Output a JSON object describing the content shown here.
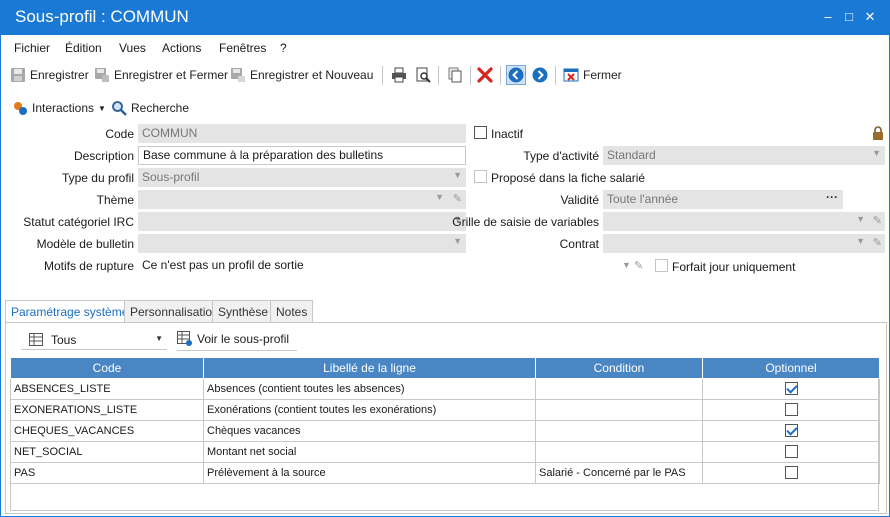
{
  "window": {
    "title": "Sous-profil : COMMUN",
    "controls": {
      "minimize": "–",
      "maximize": "□",
      "close": "✕"
    }
  },
  "menu": [
    "Fichier",
    "Édition",
    "Vues",
    "Actions",
    "Fenêtres",
    "?"
  ],
  "toolbar": {
    "save": "Enregistrer",
    "save_close": "Enregistrer et Fermer",
    "save_new": "Enregistrer et Nouveau",
    "close": "Fermer"
  },
  "toolbar2": {
    "interactions": "Interactions",
    "search": "Recherche"
  },
  "form": {
    "code": {
      "label": "Code",
      "value": "COMMUN"
    },
    "description": {
      "label": "Description",
      "value": "Base commune à la préparation des bulletins"
    },
    "type_profil": {
      "label": "Type du profil",
      "value": "Sous-profil"
    },
    "theme": {
      "label": "Thème",
      "value": ""
    },
    "statut_irc": {
      "label": "Statut catégoriel IRC",
      "value": ""
    },
    "modele_bulletin": {
      "label": "Modèle de bulletin",
      "value": ""
    },
    "motifs_rupture": {
      "label": "Motifs de rupture",
      "value": "Ce n'est pas un profil de sortie"
    },
    "inactif": {
      "label": "Inactif",
      "checked": false
    },
    "type_activite": {
      "label": "Type d'activité",
      "value": "Standard"
    },
    "propose_fiche": {
      "label": "Proposé dans la fiche salarié",
      "checked": false
    },
    "validite": {
      "label": "Validité",
      "value": "Toute l'année"
    },
    "grille_saisie": {
      "label": "Grille de saisie de variables",
      "value": ""
    },
    "contrat": {
      "label": "Contrat",
      "value": ""
    },
    "forfait_jour": {
      "label": "Forfait jour uniquement",
      "checked": false
    }
  },
  "tabs": [
    "Paramétrage système",
    "Personnalisation",
    "Synthèse",
    "Notes"
  ],
  "filter": {
    "value": "Tous",
    "view_subprofile": "Voir le sous-profil"
  },
  "grid": {
    "columns": [
      "Code",
      "Libellé de la ligne",
      "Condition",
      "Optionnel"
    ],
    "rows": [
      {
        "code": "ABSENCES_LISTE",
        "label": "Absences (contient toutes les absences)",
        "condition": "",
        "optional": true
      },
      {
        "code": "EXONERATIONS_LISTE",
        "label": "Exonérations (contient toutes les exonérations)",
        "condition": "",
        "optional": false
      },
      {
        "code": "CHEQUES_VACANCES",
        "label": "Chèques vacances",
        "condition": "",
        "optional": true
      },
      {
        "code": "NET_SOCIAL",
        "label": "Montant net social",
        "condition": "",
        "optional": false
      },
      {
        "code": "PAS",
        "label": "Prélèvement à la source",
        "condition": "Salarié - Concerné par le PAS",
        "optional": false
      }
    ]
  },
  "colors": {
    "accent": "#1a79d4",
    "grid_header": "#4a86c3",
    "readonly_field": "#e4e4e4",
    "delete_red": "#d9261c"
  }
}
